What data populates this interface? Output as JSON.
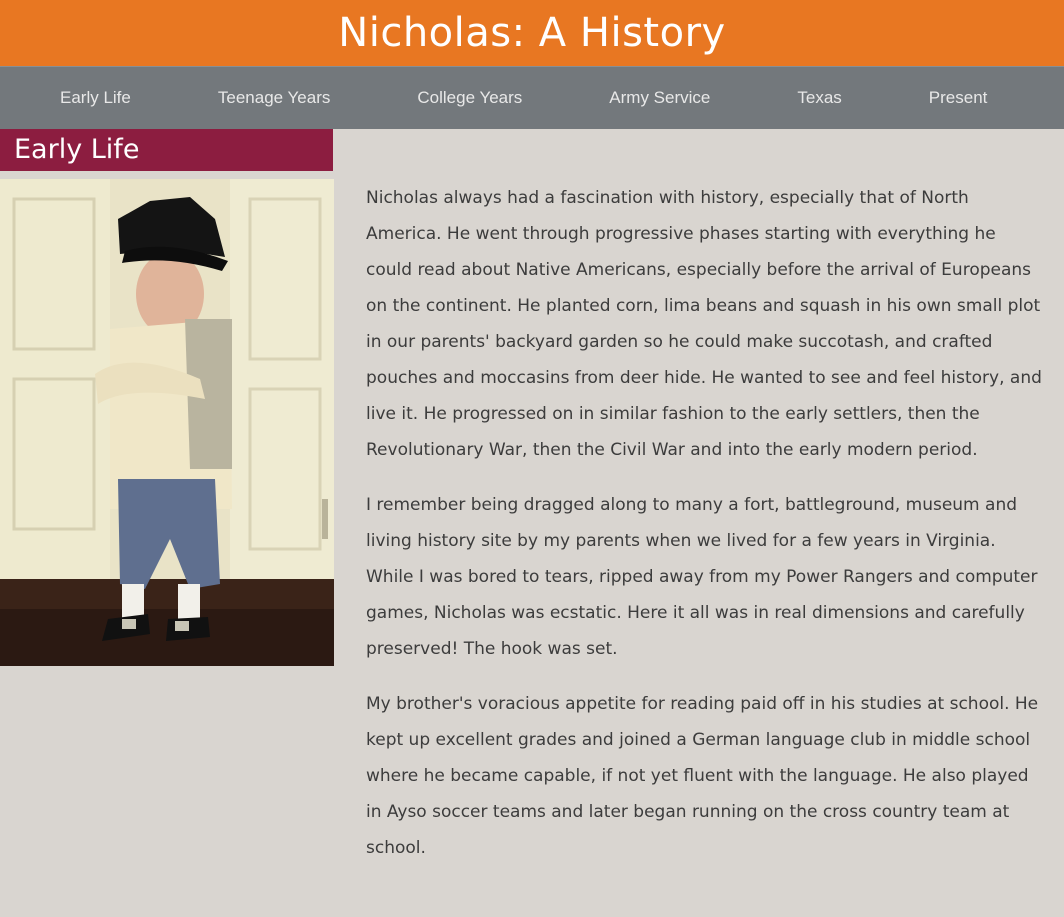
{
  "header": {
    "title": "Nicholas: A History"
  },
  "nav": {
    "items": [
      {
        "label": "Early Life"
      },
      {
        "label": "Teenage Years"
      },
      {
        "label": "College Years"
      },
      {
        "label": "Army Service"
      },
      {
        "label": "Texas"
      },
      {
        "label": "Present"
      }
    ]
  },
  "section": {
    "title": "Early Life",
    "paragraphs": [
      "Nicholas always had a fascination with history, especially that of North America. He went through progressive phases starting with everything he could read about Native Americans, especially before the arrival of Europeans on the continent. He planted corn, lima beans and squash in his own small plot in our parents' backyard garden so he could make succotash, and crafted pouches and moccasins from deer hide. He wanted to see and feel history, and live it. He progressed on in similar fashion to the early settlers, then the Revolutionary War, then the Civil War and into the early modern period.",
      "I remember being dragged along to many a fort, battleground, museum and living history site by my parents when we lived for a few years in Virginia. While I was bored to tears, ripped away from my Power Rangers and computer games, Nicholas was ecstatic. Here it all was in real dimensions and carefully preserved! The hook was set.",
      "My brother's voracious appetite for reading paid off in his studies at school. He kept up excellent grades and joined a German language club in middle school where he became capable, if not yet fluent with the language. He also played in Ayso soccer teams and later began running on the cross country team at school."
    ]
  },
  "colors": {
    "header_bg": "#e87722",
    "nav_bg": "#73787c",
    "section_title_bg": "#8c1d40",
    "page_bg": "#d9d5d0"
  }
}
